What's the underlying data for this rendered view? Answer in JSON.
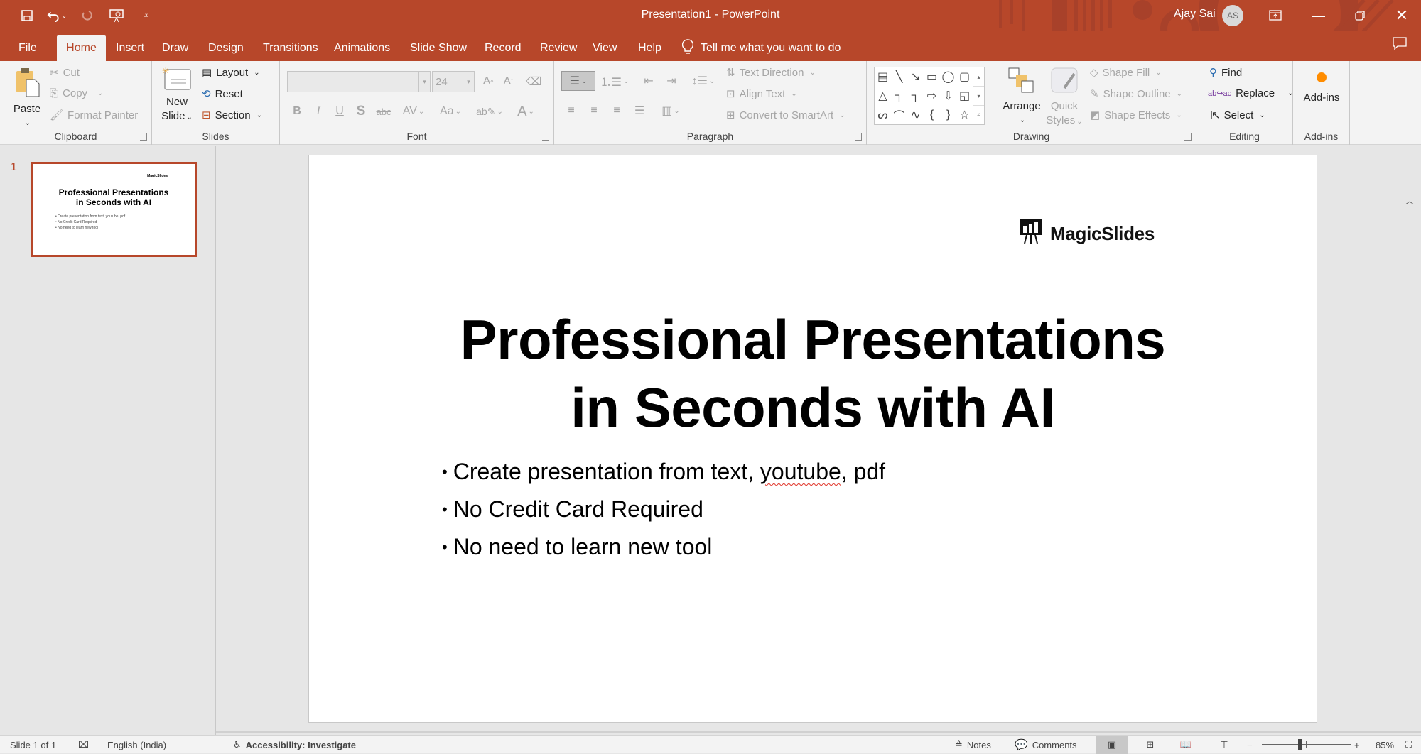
{
  "window": {
    "title": "Presentation1  -  PowerPoint",
    "user_name": "Ajay Sai",
    "user_initials": "AS",
    "accent_color": "#b7472a"
  },
  "quick_access": [
    {
      "name": "save-icon",
      "glyph": "💾"
    },
    {
      "name": "undo-icon",
      "glyph": "↶"
    },
    {
      "name": "redo-icon",
      "glyph": "↻"
    },
    {
      "name": "present-from-beginning-icon",
      "glyph": "▣"
    },
    {
      "name": "customize-qat-icon",
      "glyph": "⩡"
    }
  ],
  "tabs": [
    {
      "label": "File",
      "active": false
    },
    {
      "label": "Home",
      "active": true
    },
    {
      "label": "Insert",
      "active": false
    },
    {
      "label": "Draw",
      "active": false
    },
    {
      "label": "Design",
      "active": false
    },
    {
      "label": "Transitions",
      "active": false
    },
    {
      "label": "Animations",
      "active": false
    },
    {
      "label": "Slide Show",
      "active": false
    },
    {
      "label": "Record",
      "active": false
    },
    {
      "label": "Review",
      "active": false
    },
    {
      "label": "View",
      "active": false
    },
    {
      "label": "Help",
      "active": false
    }
  ],
  "tell_me": "Tell me what you want to do",
  "ribbon": {
    "clipboard": {
      "label": "Clipboard",
      "paste": "Paste",
      "cut": "Cut",
      "copy": "Copy",
      "format_painter": "Format Painter"
    },
    "slides": {
      "label": "Slides",
      "new_slide_line1": "New",
      "new_slide_line2": "Slide",
      "layout": "Layout",
      "reset": "Reset",
      "section": "Section"
    },
    "font": {
      "label": "Font",
      "font_name": "",
      "font_size": "24",
      "bold": "B",
      "italic": "I",
      "underline": "U",
      "shadow": "S",
      "strikethrough": "abc",
      "char_spacing": "AV",
      "change_case": "Aa",
      "font_color": "A",
      "grow": "A",
      "shrink": "A"
    },
    "paragraph": {
      "label": "Paragraph",
      "text_direction": "Text Direction",
      "align_text": "Align Text",
      "convert_smartart": "Convert to SmartArt"
    },
    "drawing": {
      "label": "Drawing",
      "shapes": [
        "▤",
        "╲",
        "↘",
        "▭",
        "◯",
        "▢",
        "△",
        "┐",
        "┐",
        "⇨",
        "⇩",
        "◱",
        "ᔕ",
        "⌒",
        "∿",
        "{",
        "}",
        "☆"
      ],
      "arrange": "Arrange",
      "quick_styles_line1": "Quick",
      "quick_styles_line2": "Styles",
      "shape_fill": "Shape Fill",
      "shape_outline": "Shape Outline",
      "shape_effects": "Shape Effects"
    },
    "editing": {
      "label": "Editing",
      "find": "Find",
      "replace": "Replace",
      "select": "Select"
    },
    "addins": {
      "label": "Add-ins",
      "button": "Add-ins"
    }
  },
  "thumbnails": [
    {
      "number": "1",
      "logo": "MagicSlides",
      "title_line1": "Professional Presentations",
      "title_line2": "in Seconds with AI",
      "bullets": [
        "• Create presentation from text, youtube, pdf",
        "• No Credit Card Required",
        "• No need to learn new tool"
      ]
    }
  ],
  "slide": {
    "logo_text": "MagicSlides",
    "title_line1": "Professional Presentations",
    "title_line2": "in Seconds with AI",
    "bullet1_pre": "Create presentation from text, ",
    "bullet1_misspelled": "youtube",
    "bullet1_post": ", pdf",
    "bullet2": "No Credit Card Required",
    "bullet3": "No need to learn new tool",
    "bullet_glyph": "•"
  },
  "status": {
    "slide_counter": "Slide 1 of 1",
    "language": "English (India)",
    "accessibility": "Accessibility: Investigate",
    "notes": "Notes",
    "comments": "Comments",
    "zoom_level": "85%",
    "zoom_minus": "−",
    "zoom_plus": "+"
  }
}
